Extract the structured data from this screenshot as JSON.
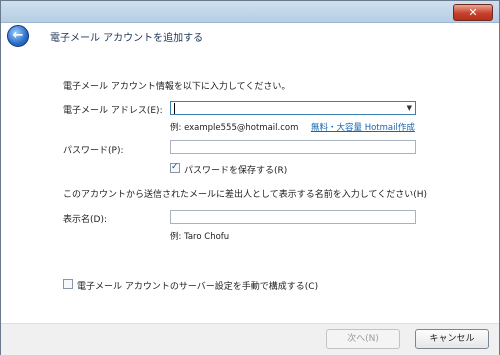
{
  "window": {
    "close_glyph": "✕"
  },
  "header": {
    "back_glyph": "←",
    "title": "電子メール アカウントを追加する"
  },
  "form": {
    "intro": "電子メール アカウント情報を以下に入力してください。",
    "email": {
      "label": "電子メール アドレス(E):",
      "value": "",
      "example": "例: example555@hotmail.com",
      "signup_link": "無料・大容量 Hotmail作成",
      "dropdown_glyph": "▼"
    },
    "password": {
      "label": "パスワード(P):",
      "value": "",
      "save_checkbox": {
        "label": "パスワードを保存する(R)",
        "checked": true,
        "glyph": "✓"
      }
    },
    "display_name_instruction": "このアカウントから送信されたメールに差出人として表示する名前を入力してください(H)",
    "display_name": {
      "label": "表示名(D):",
      "value": "",
      "example": "例: Taro Chofu"
    },
    "manual_config_checkbox": {
      "label": "電子メール アカウントのサーバー設定を手動で構成する(C)",
      "checked": false
    }
  },
  "footer": {
    "next_label": "次へ(N)",
    "cancel_label": "キャンセル",
    "next_enabled": false
  },
  "colors": {
    "link": "#1565b0",
    "header_text": "#1d3557",
    "close_button": "#c7402b"
  }
}
